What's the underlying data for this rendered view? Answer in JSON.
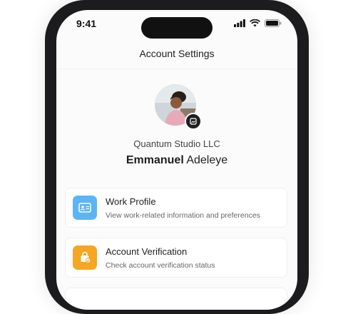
{
  "status_bar": {
    "time": "9:41"
  },
  "header": {
    "title": "Account Settings"
  },
  "profile": {
    "company": "Quantum Studio LLC",
    "first_name": "Emmanuel",
    "last_name": "Adeleye"
  },
  "menu": [
    {
      "title": "Work Profile",
      "subtitle": "View work-related information and preferences",
      "icon": "id-card-icon",
      "color": "#5bb5f5"
    },
    {
      "title": "Account Verification",
      "subtitle": "Check account verification status",
      "icon": "verified-badge-icon",
      "color": "#f5a623"
    }
  ]
}
